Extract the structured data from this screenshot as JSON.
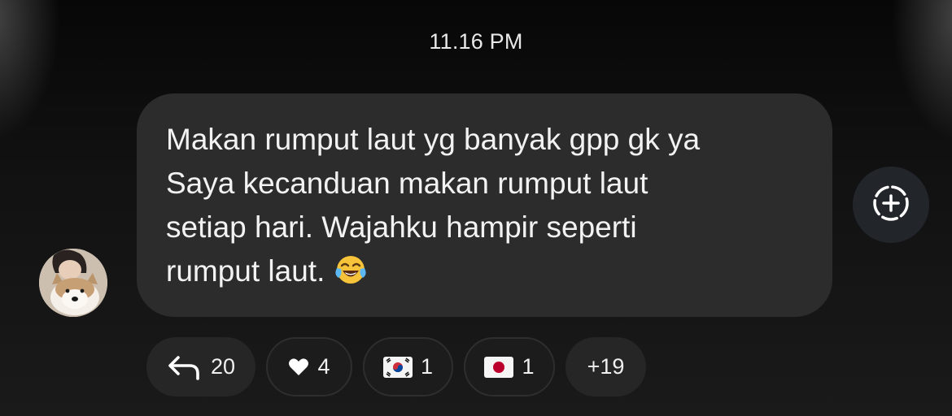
{
  "header": {
    "timestamp": "11.16 PM"
  },
  "message": {
    "lines": [
      "Makan rumput laut yg banyak gpp gk ya",
      "Saya kecanduan makan rumput laut",
      "setiap hari. Wajahku hampir seperti",
      "rumput laut."
    ],
    "emoji": "face-with-tears-of-joy"
  },
  "actions": {
    "add_reaction_icon": "add-reaction-icon"
  },
  "reactions": [
    {
      "icon": "reply-arrow-icon",
      "count": "20"
    },
    {
      "icon": "heart-icon",
      "count": "4"
    },
    {
      "icon": "south-korea-flag-icon",
      "count": "1"
    },
    {
      "icon": "japan-flag-icon",
      "count": "1"
    },
    {
      "label": "+19"
    }
  ]
}
